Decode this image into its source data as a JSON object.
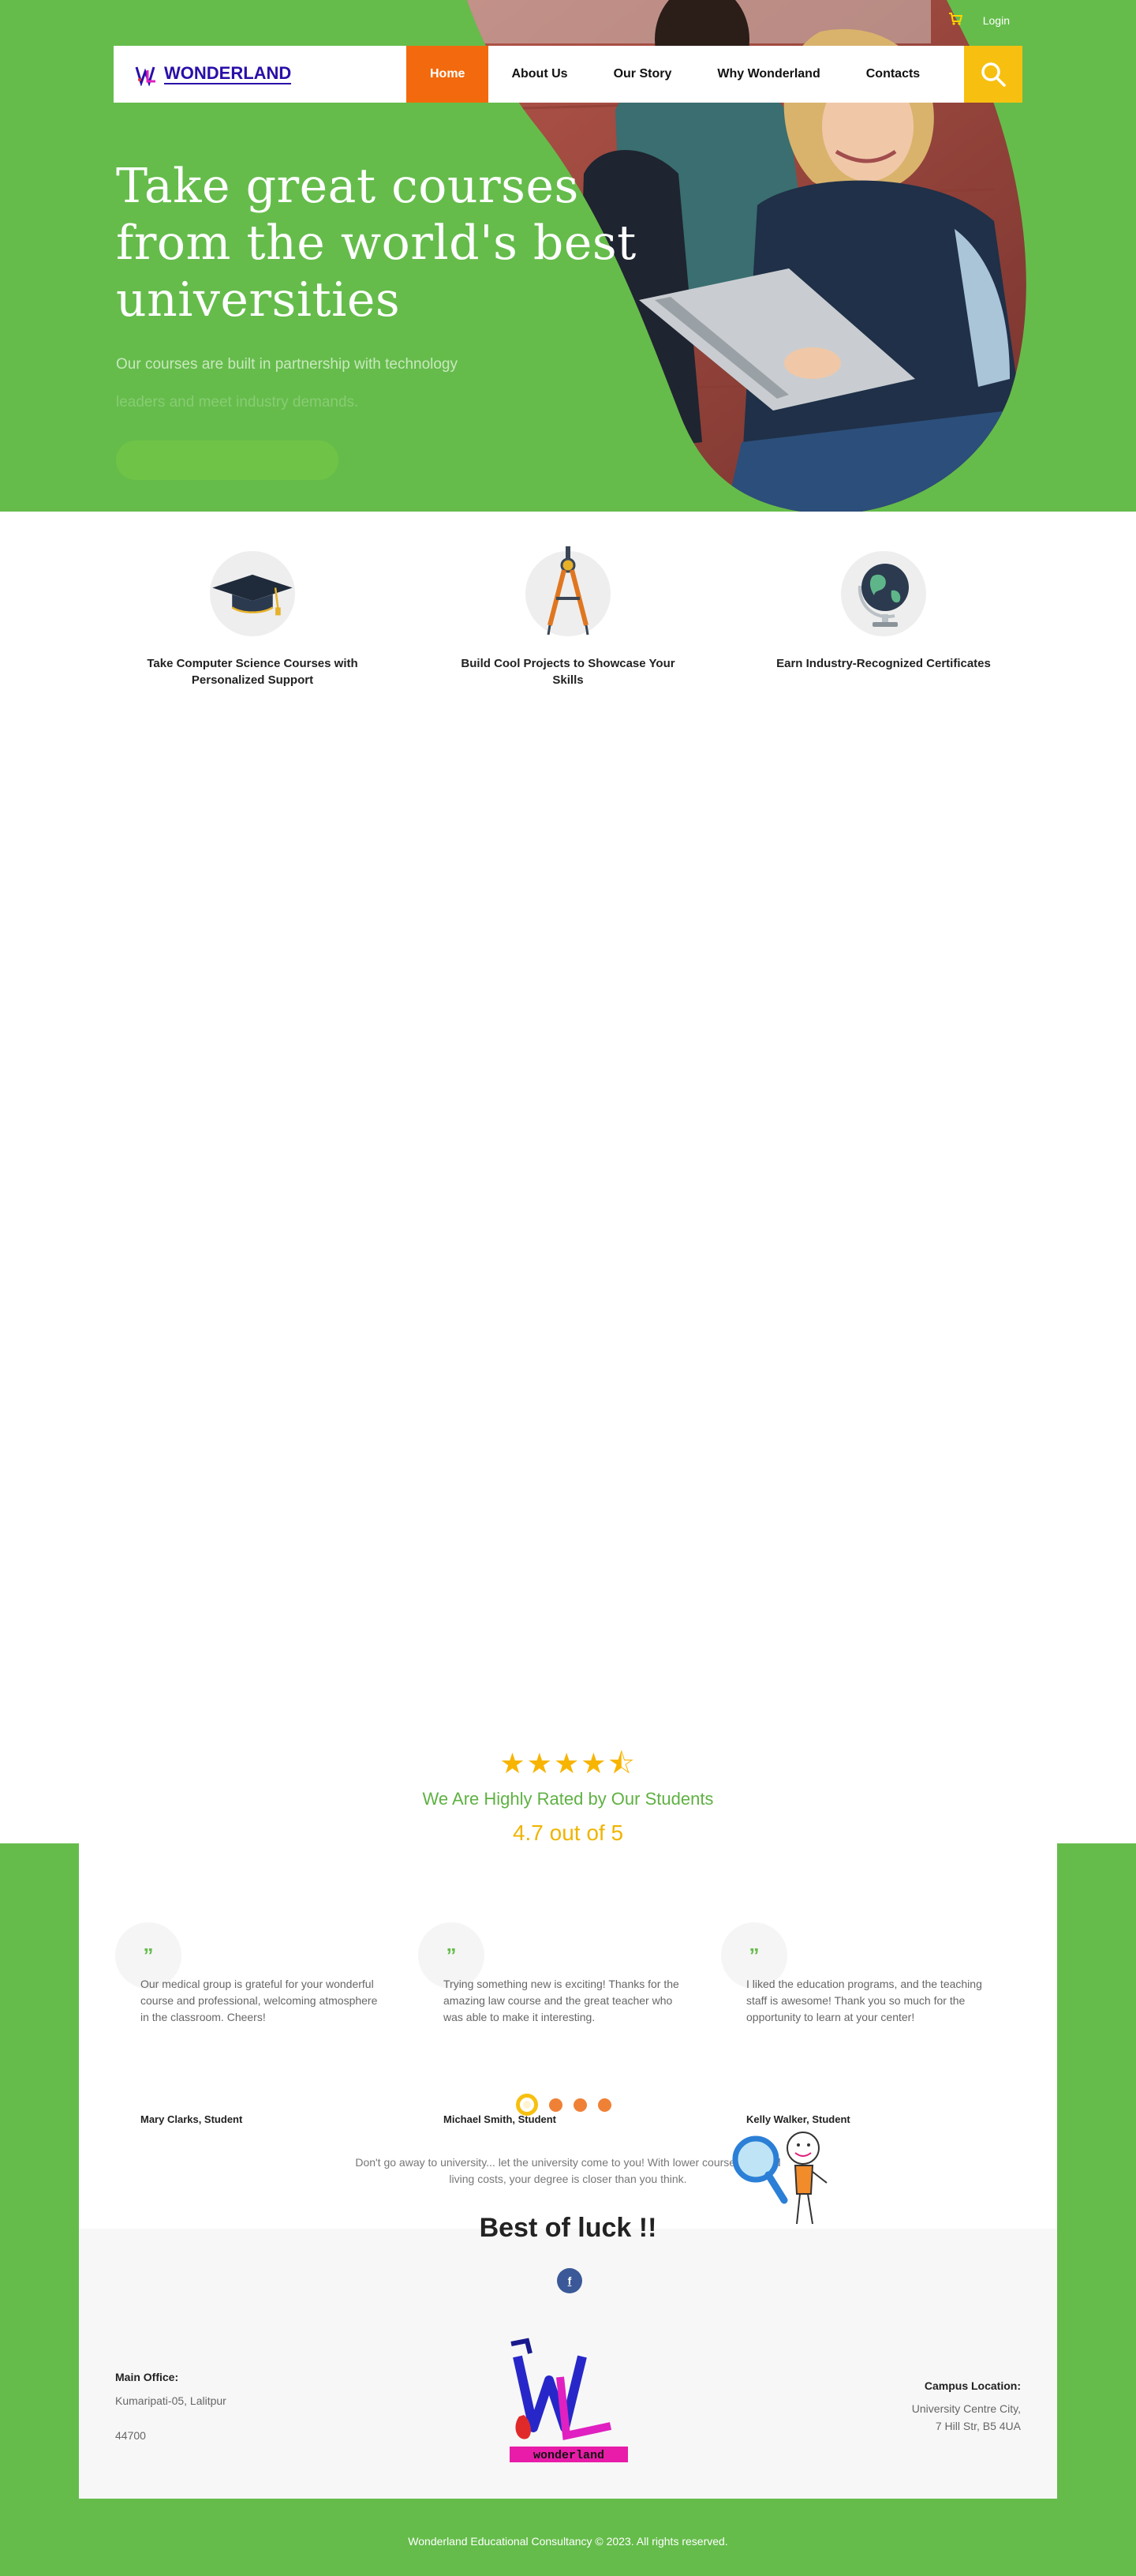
{
  "colors": {
    "green": "#65bc4b",
    "orange": "#f26a0d",
    "yellow": "#f7c010",
    "brand_blue": "#2a0ea8"
  },
  "topbar": {
    "cart_icon": "shopping-cart-icon",
    "login": "Login"
  },
  "nav": {
    "brand": "WONDERLAND",
    "items": [
      {
        "label": "Home",
        "active": true
      },
      {
        "label": "About Us"
      },
      {
        "label": "Our Story"
      },
      {
        "label": "Why Wonderland"
      },
      {
        "label": "Contacts"
      }
    ],
    "search_icon": "search-icon"
  },
  "hero": {
    "title_line1": "Take great courses",
    "title_line2": "from the world's best",
    "title_line3": "universities",
    "subtitle_line1": "Our courses are built in partnership with technology",
    "subtitle_line2": "leaders and meet industry demands."
  },
  "features": [
    {
      "icon": "graduation-cap-icon",
      "label": "Take Computer Science Courses with Personalized Support"
    },
    {
      "icon": "compass-icon",
      "label": "Build Cool Projects to Showcase Your Skills"
    },
    {
      "icon": "globe-icon",
      "label": "Earn Industry-Recognized Certificates"
    }
  ],
  "rating": {
    "stars": "★★★★⯪",
    "value": 4.5,
    "heading": "We Are Highly Rated by Our Students",
    "score": "4.7 out of 5"
  },
  "testimonials": [
    {
      "text": "Our medical group is grateful for your wonderful course and professional, welcoming atmosphere in the classroom. Cheers!",
      "author": "Mary Clarks,  Student"
    },
    {
      "text": "Trying something new is exciting! Thanks for the amazing law course and the great teacher who was able to make it interesting.",
      "author": "Michael Smith,  Student"
    },
    {
      "text": "I liked the education programs, and the teaching staff is awesome! Thank you so much for the opportunity to learn at your center!",
      "author": "Kelly Walker,  Student"
    }
  ],
  "quote_mark": "”",
  "motto": "Don't go away to university... let the university come to you! With lower course fees and living costs, your degree is closer than you think.",
  "luck": "Best of luck !!",
  "facebook": "f",
  "footer": {
    "main_office_title": "Main Office:",
    "main_office_address": "Kumaripati-05, Lalitpur",
    "main_office_zip": "44700",
    "logo_text": "wonderland",
    "campus_title": "Campus Location:",
    "campus_line1": "University Centre City,",
    "campus_line2": "7 Hill Str, B5 4UA",
    "copyright": "Wonderland Educational Consultancy © 2023. All rights reserved."
  }
}
